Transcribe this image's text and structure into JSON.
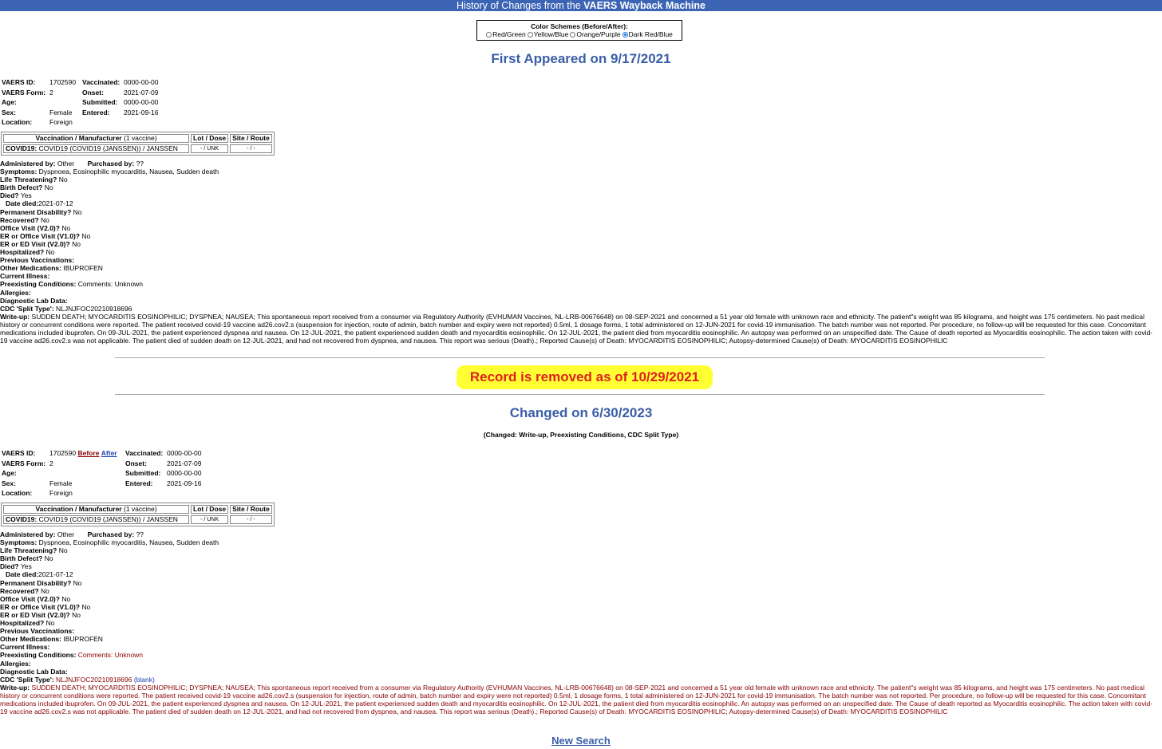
{
  "header": {
    "title_prefix": "History of Changes from the ",
    "title_bold": "VAERS Wayback Machine"
  },
  "color_schemes": {
    "title": "Color Schemes (Before/After):",
    "options": [
      "Red/Green",
      "Yellow/Blue",
      "Orange/Purple",
      "Dark Red/Blue"
    ],
    "selected": "Dark Red/Blue"
  },
  "first_heading": "First Appeared on 9/17/2021",
  "removed_heading": "Record is removed as of 10/29/2021",
  "changed_heading": "Changed on 6/30/2023",
  "changed_note": "(Changed: Write-up, Preexisting Conditions, CDC Split Type)",
  "labels": {
    "vaers_id": "VAERS ID:",
    "vaers_form": "VAERS Form:",
    "age": "Age:",
    "sex": "Sex:",
    "location": "Location:",
    "vaccinated": "Vaccinated:",
    "onset": "Onset:",
    "submitted": "Submitted:",
    "entered": "Entered:",
    "vax_header": "Vaccination / Manufacturer",
    "vax_count": "(1 vaccine)",
    "lot_dose": "Lot / Dose",
    "site_route": "Site / Route",
    "administered_by": "Administered by:",
    "purchased_by": "Purchased by:",
    "symptoms": "Symptoms:",
    "life_threatening": "Life Threatening?",
    "birth_defect": "Birth Defect?",
    "died": "Died?",
    "date_died": "Date died:",
    "permanent_disability": "Permanent Disability?",
    "recovered": "Recovered?",
    "office_visit": "Office Visit (V2.0)?",
    "er_office_visit": "ER or Office Visit (V1.0)?",
    "er_ed_visit": "ER or ED Visit (V2.0)?",
    "hospitalized": "Hospitalized?",
    "previous_vaccinations": "Previous Vaccinations:",
    "other_medications": "Other Medications:",
    "current_illness": "Current Illness:",
    "preexisting": "Preexisting Conditions:",
    "allergies": "Allergies:",
    "diagnostic": "Diagnostic Lab Data:",
    "cdc_split": "CDC 'Split Type':",
    "writeup": "Write-up:"
  },
  "record": {
    "vaers_id": "1702590",
    "vaers_form": "2",
    "age": "",
    "sex": "Female",
    "location": "Foreign",
    "vaccinated": "0000-00-00",
    "onset": "2021-07-09",
    "submitted": "0000-00-00",
    "entered": "2021-09-16",
    "vax_name_bold": "COVID19:",
    "vax_name": "COVID19 (COVID19 (JANSSEN)) / JANSSEN",
    "lot_dose": "- / UNK",
    "site_route": "- / -",
    "administered_by": "Other",
    "purchased_by": "??",
    "symptoms": "Dyspnoea, Eosinophilic myocarditis, Nausea, Sudden death",
    "life_threatening": "No",
    "birth_defect": "No",
    "died": "Yes",
    "date_died": "2021-07-12",
    "permanent_disability": "No",
    "recovered": "No",
    "office_visit": "No",
    "er_office_visit": "No",
    "er_ed_visit": "No",
    "hospitalized": "No",
    "previous_vaccinations": "",
    "other_medications": "IBUPROFEN",
    "current_illness": "",
    "preexisting": "Comments: Unknown",
    "allergies": "",
    "diagnostic": "",
    "cdc_split": "NLJNJFOC20210918696",
    "writeup": "SUDDEN DEATH; MYOCARDITIS EOSINOPHILIC; DYSPNEA; NAUSEA; This spontaneous report received from a consumer via Regulatory Authority (EVHUMAN Vaccines, NL-LRB-00676648) on 08-SEP-2021 and concerned a 51 year old female with unknown race and ethnicity. The patient\"s weight was 85 kilograms, and height was 175 centimeters. No past medical history or concurrent conditions were reported. The patient received covid-19 vaccine ad26.cov2.s (suspension for injection, route of admin, batch number and expiry were not reported) 0.5ml, 1 dosage forms, 1 total administered on 12-JUN-2021 for covid-19 immunisation. The batch number was not reported. Per procedure, no follow-up will be requested for this case. Concomitant medications included ibuprofen. On 09-JUL-2021, the patient experienced dyspnea and nausea. On 12-JUL-2021, the patient experienced sudden death and myocarditis eosinophilic. On 12-JUL-2021, the patient died from myocarditis eosinophilic. An autopsy was performed on an unspecified date. The Cause of death reported as Myocarditis eosinophilic. The action taken with covid-19 vaccine ad26.cov2.s was not applicable. The patient died of sudden death on 12-JUL-2021, and had not recovered from dyspnea, and nausea. This report was serious (Death).; Reported Cause(s) of Death: MYOCARDITIS EOSINOPHILIC; Autopsy-determined Cause(s) of Death: MYOCARDITIS EOSINOPHILIC"
  },
  "changed_links": {
    "before": "Before",
    "after": "After"
  },
  "cdc_split_after": "(blank)",
  "new_search": "New Search",
  "colors": {
    "header_bar": "#3b64b5",
    "heading_blue": "#3a5ea8",
    "removed_red": "#e02020",
    "highlight": "#ffff33",
    "before_red": "#8b0000",
    "after_blue": "#1a3faf"
  }
}
